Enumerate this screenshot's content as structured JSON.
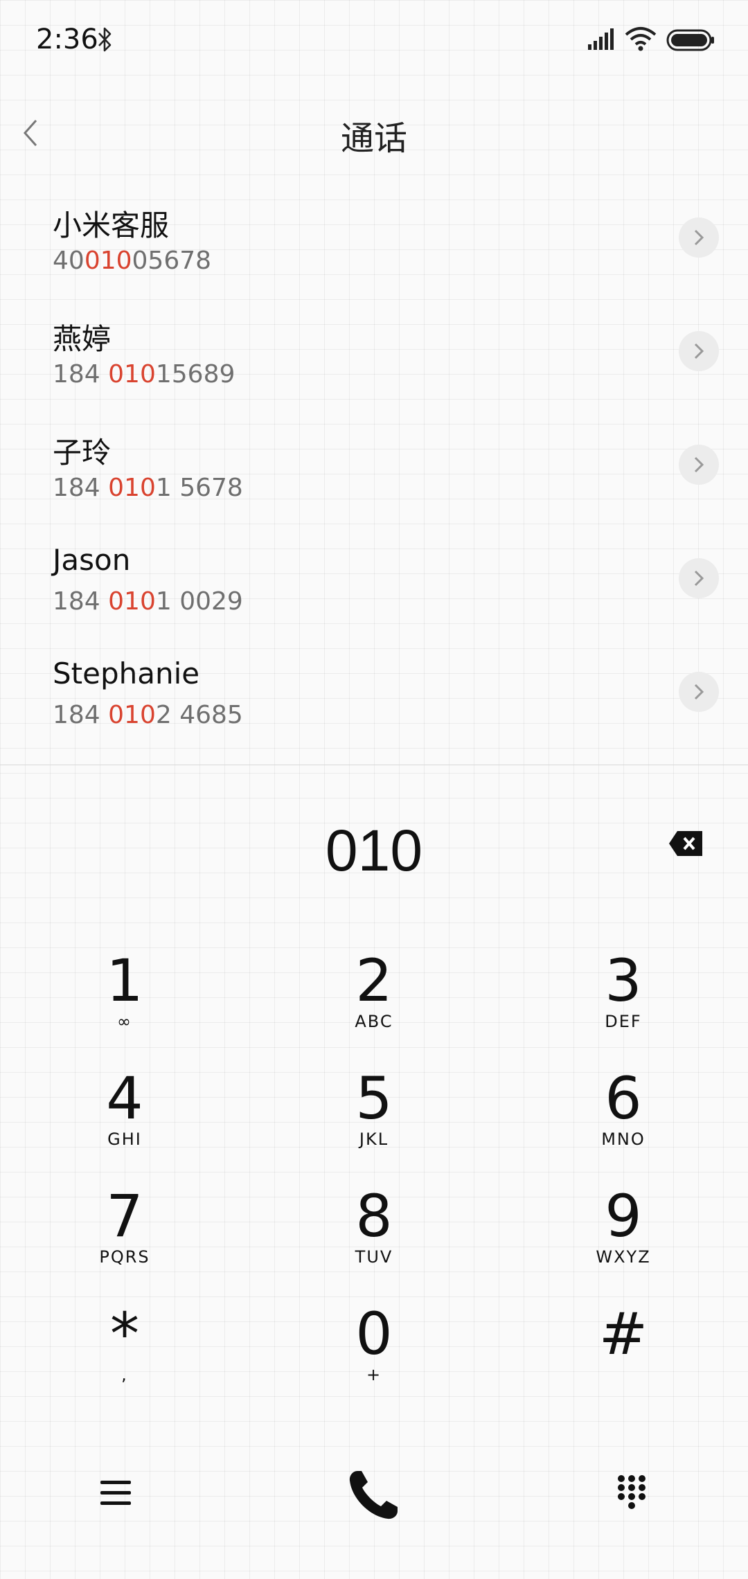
{
  "status": {
    "time": "2:36",
    "icons": [
      "bluetooth-icon",
      "signal-icon",
      "wifi-icon",
      "battery-icon"
    ]
  },
  "header": {
    "title": "通话",
    "back_icon": "back-icon"
  },
  "contacts": [
    {
      "name": "小米客服",
      "number_before": "40",
      "number_match": "010",
      "number_after": "05678"
    },
    {
      "name": "燕婷",
      "number_before": "184 ",
      "number_match": "010",
      "number_after": "15689"
    },
    {
      "name": "子玲",
      "number_before": "184 ",
      "number_match": "010",
      "number_after": "1 5678"
    },
    {
      "name": "Jason",
      "number_before": "184 ",
      "number_match": "010",
      "number_after": "1 0029"
    },
    {
      "name": "Stephanie",
      "number_before": "184 ",
      "number_match": "010",
      "number_after": "2 4685"
    }
  ],
  "dialer": {
    "input_value": "010",
    "keys": [
      {
        "digit": "1",
        "letters": "∞"
      },
      {
        "digit": "2",
        "letters": "ABC"
      },
      {
        "digit": "3",
        "letters": "DEF"
      },
      {
        "digit": "4",
        "letters": "GHI"
      },
      {
        "digit": "5",
        "letters": "JKL"
      },
      {
        "digit": "6",
        "letters": "MNO"
      },
      {
        "digit": "7",
        "letters": "PQRS"
      },
      {
        "digit": "8",
        "letters": "TUV"
      },
      {
        "digit": "9",
        "letters": "WXYZ"
      },
      {
        "digit": "*",
        "letters": ","
      },
      {
        "digit": "0",
        "letters": "+"
      },
      {
        "digit": "#",
        "letters": ""
      }
    ]
  },
  "colors": {
    "highlight": "#d9432f",
    "number_gray": "#6f6f6f",
    "background": "#fafafa"
  }
}
